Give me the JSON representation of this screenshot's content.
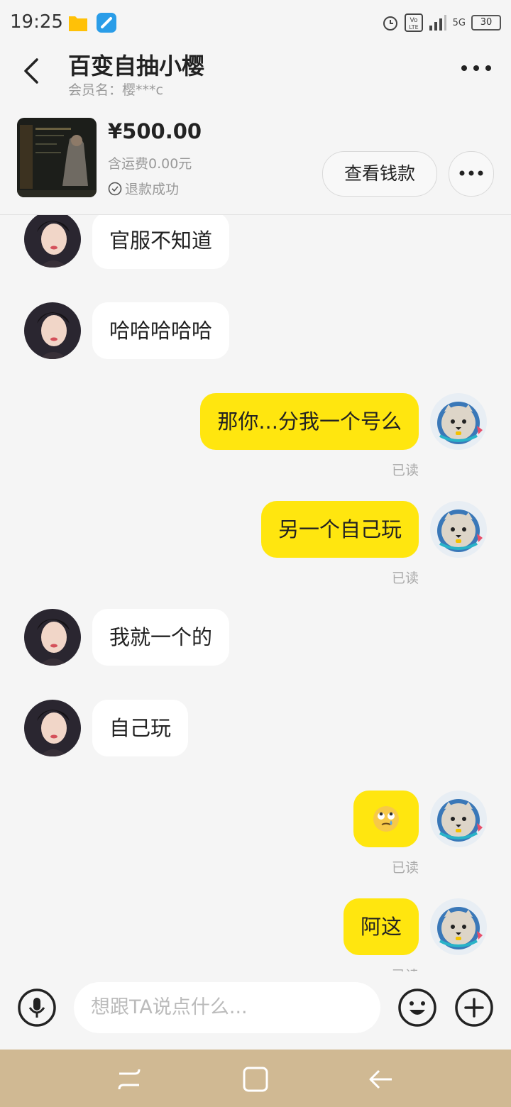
{
  "status_bar": {
    "time": "19:25",
    "network": "5G",
    "battery": "30"
  },
  "header": {
    "title": "百变自抽小樱",
    "member_label": "会员名：樱***c"
  },
  "product": {
    "price": "¥500.00",
    "shipping": "含运费0.00元",
    "status": "退款成功",
    "view_money_button": "查看钱款"
  },
  "messages": [
    {
      "side": "in",
      "text": "官服不知道"
    },
    {
      "side": "in",
      "text": "哈哈哈哈哈"
    },
    {
      "side": "out",
      "text": "那你...分我一个号么",
      "read": "已读"
    },
    {
      "side": "out",
      "text": "另一个自己玩",
      "read": "已读"
    },
    {
      "side": "in",
      "text": "我就一个的"
    },
    {
      "side": "in",
      "text": "自己玩"
    },
    {
      "side": "out",
      "emoji": "rolling-eyes-emoji",
      "read": "已读"
    },
    {
      "side": "out",
      "text": "阿这",
      "read": "已读"
    }
  ],
  "input": {
    "placeholder": "想跟TA说点什么..."
  },
  "colors": {
    "accent": "#ffe60f",
    "background": "#f5f5f5",
    "nav_bar": "#d0b993"
  }
}
